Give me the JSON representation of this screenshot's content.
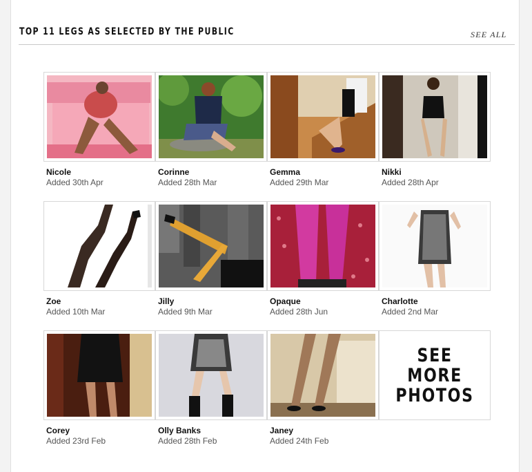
{
  "section": {
    "title": "TOP 11 LEGS AS SELECTED BY THE PUBLIC",
    "see_all": "SEE ALL"
  },
  "photos": [
    {
      "name": "Nicole",
      "added": "Added 30th Apr"
    },
    {
      "name": "Corinne",
      "added": "Added 28th Mar"
    },
    {
      "name": "Gemma",
      "added": "Added 29th Mar"
    },
    {
      "name": "Nikki",
      "added": "Added 28th Apr"
    },
    {
      "name": "Zoe",
      "added": "Added 10th Mar"
    },
    {
      "name": "Jilly",
      "added": "Added 9th Mar"
    },
    {
      "name": "Opaque",
      "added": "Added 28th Jun"
    },
    {
      "name": "Charlotte",
      "added": "Added 2nd Mar"
    },
    {
      "name": "Corey",
      "added": "Added 23rd Feb"
    },
    {
      "name": "Olly Banks",
      "added": "Added 28th Feb"
    },
    {
      "name": "Janey",
      "added": "Added 24th Feb"
    }
  ],
  "see_more": {
    "label": "SEE\nMORE\nPHOTOS"
  }
}
